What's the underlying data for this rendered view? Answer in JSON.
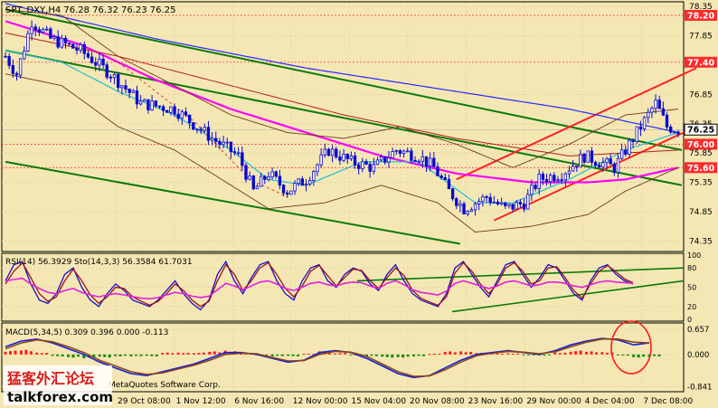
{
  "chart_data": [
    {
      "type": "candlestick",
      "panel": "price",
      "title": "SPT_DXY,H4  76.28 76.32 76.23 76.25",
      "ylim": [
        74.2,
        78.4
      ],
      "y_ticks": [
        74.35,
        74.85,
        75.35,
        75.85,
        76.35,
        76.85,
        77.85,
        78.35
      ],
      "price_labels": [
        {
          "value": 78.2,
          "text": "78.20",
          "color": "#ff2a2a"
        },
        {
          "value": 77.4,
          "text": "77.40",
          "color": "#ff2a2a"
        },
        {
          "value": 76.25,
          "text": "76.25",
          "color": "#ffffff"
        },
        {
          "value": 76.0,
          "text": "76.00",
          "color": "#ff2a2a"
        },
        {
          "value": 75.6,
          "text": "75.60",
          "color": "#ff2a2a"
        }
      ],
      "bars": 180,
      "x_tick_labels": [
        "29 Oct 08:00",
        "1 Nov 12:00",
        "6 Nov 16:00",
        "12 Nov 00:00",
        "15 Nov 04:00",
        "20 Nov 08:00",
        "23 Nov 16:00",
        "29 Nov 00:00",
        "4 Dec 04:00",
        "7 Dec 08:00"
      ],
      "close_anchors": [
        [
          0,
          77.5
        ],
        [
          3,
          77.2
        ],
        [
          7,
          78.1
        ],
        [
          12,
          77.8
        ],
        [
          20,
          77.6
        ],
        [
          28,
          77.2
        ],
        [
          36,
          76.7
        ],
        [
          45,
          76.6
        ],
        [
          55,
          76.1
        ],
        [
          62,
          75.8
        ],
        [
          66,
          75.2
        ],
        [
          70,
          75.5
        ],
        [
          75,
          75.2
        ],
        [
          80,
          75.4
        ],
        [
          86,
          75.9
        ],
        [
          92,
          75.7
        ],
        [
          98,
          75.6
        ],
        [
          104,
          75.9
        ],
        [
          110,
          75.8
        ],
        [
          114,
          75.6
        ],
        [
          118,
          75.2
        ],
        [
          122,
          74.9
        ],
        [
          125,
          75.0
        ],
        [
          128,
          75.1
        ],
        [
          133,
          74.9
        ],
        [
          138,
          75.0
        ],
        [
          142,
          75.4
        ],
        [
          148,
          75.5
        ],
        [
          154,
          75.8
        ],
        [
          158,
          75.7
        ],
        [
          162,
          75.6
        ],
        [
          166,
          76.0
        ],
        [
          170,
          76.4
        ],
        [
          173,
          76.7
        ],
        [
          176,
          76.3
        ],
        [
          179,
          76.25
        ]
      ],
      "lines": {
        "magenta_ma": [
          [
            0,
            78.1
          ],
          [
            20,
            77.7
          ],
          [
            40,
            77.1
          ],
          [
            60,
            76.6
          ],
          [
            80,
            76.2
          ],
          [
            100,
            75.8
          ],
          [
            120,
            75.5
          ],
          [
            140,
            75.35
          ],
          [
            155,
            75.35
          ],
          [
            165,
            75.4
          ],
          [
            179,
            75.6
          ]
        ],
        "blue_ma": [
          [
            0,
            78.4
          ],
          [
            40,
            77.8
          ],
          [
            80,
            77.3
          ],
          [
            120,
            76.9
          ],
          [
            150,
            76.6
          ],
          [
            179,
            76.2
          ]
        ],
        "cyan_ma": [
          [
            0,
            77.6
          ],
          [
            15,
            77.4
          ],
          [
            30,
            76.9
          ],
          [
            45,
            76.5
          ],
          [
            60,
            75.9
          ],
          [
            70,
            75.4
          ],
          [
            80,
            75.3
          ],
          [
            95,
            75.7
          ],
          [
            110,
            75.7
          ],
          [
            125,
            75.0
          ],
          [
            135,
            75.0
          ],
          [
            150,
            75.4
          ],
          [
            165,
            75.9
          ],
          [
            179,
            76.2
          ]
        ],
        "red_ma": [
          [
            0,
            77.9
          ],
          [
            30,
            77.5
          ],
          [
            60,
            77.0
          ],
          [
            90,
            76.5
          ],
          [
            120,
            76.1
          ],
          [
            150,
            75.8
          ],
          [
            179,
            75.9
          ]
        ],
        "bollinger_upper": [
          [
            0,
            78.3
          ],
          [
            15,
            78.2
          ],
          [
            30,
            77.5
          ],
          [
            45,
            77.0
          ],
          [
            60,
            76.5
          ],
          [
            75,
            76.2
          ],
          [
            90,
            76.1
          ],
          [
            105,
            76.3
          ],
          [
            120,
            76.0
          ],
          [
            135,
            75.6
          ],
          [
            150,
            76.0
          ],
          [
            165,
            76.5
          ],
          [
            179,
            76.6
          ]
        ],
        "bollinger_lower": [
          [
            0,
            77.2
          ],
          [
            15,
            77.0
          ],
          [
            30,
            76.3
          ],
          [
            45,
            75.9
          ],
          [
            60,
            75.3
          ],
          [
            70,
            74.9
          ],
          [
            85,
            75.0
          ],
          [
            100,
            75.3
          ],
          [
            115,
            75.0
          ],
          [
            125,
            74.5
          ],
          [
            140,
            74.6
          ],
          [
            155,
            74.8
          ],
          [
            165,
            75.2
          ],
          [
            179,
            75.6
          ]
        ],
        "dashed_red": [
          [
            30,
            77.4
          ],
          [
            50,
            76.4
          ],
          [
            65,
            75.4
          ],
          [
            75,
            75.1
          ]
        ]
      },
      "trendlines": [
        {
          "name": "green-channel-upper",
          "color": "#0a7a0a",
          "from": [
            0,
            78.3
          ],
          "to": [
            179,
            75.9
          ]
        },
        {
          "name": "green-channel-mid",
          "color": "#0a7a0a",
          "from": [
            0,
            77.6
          ],
          "to": [
            179,
            75.3
          ]
        },
        {
          "name": "green-channel-lower",
          "color": "#0a7a0a",
          "from": [
            0,
            75.7
          ],
          "to": [
            120,
            74.3
          ]
        },
        {
          "name": "red-channel-upper",
          "color": "#ff2222",
          "from": [
            120,
            75.4
          ],
          "to": [
            179,
            77.3
          ]
        },
        {
          "name": "red-channel-lower",
          "color": "#ff2222",
          "from": [
            130,
            74.7
          ],
          "to": [
            179,
            76.3
          ]
        }
      ]
    },
    {
      "type": "line",
      "panel": "rsi",
      "title": "RSI(14) 56.3929  Sto(14,3,3) 56.3584 61.7031",
      "ylim": [
        0,
        100
      ],
      "y_ticks": [
        0,
        20,
        50,
        80,
        100
      ],
      "series": [
        {
          "name": "Sto main",
          "color": "#1010d0",
          "values": [
            60,
            85,
            90,
            55,
            30,
            25,
            40,
            70,
            80,
            50,
            30,
            20,
            40,
            55,
            45,
            30,
            25,
            20,
            30,
            45,
            60,
            40,
            25,
            15,
            30,
            70,
            90,
            60,
            40,
            65,
            85,
            90,
            60,
            40,
            30,
            60,
            80,
            85,
            60,
            50,
            70,
            80,
            75,
            55,
            45,
            70,
            85,
            60,
            40,
            30,
            25,
            20,
            40,
            80,
            90,
            70,
            50,
            35,
            60,
            85,
            90,
            70,
            50,
            65,
            85,
            80,
            60,
            40,
            30,
            60,
            80,
            85,
            70,
            60,
            55
          ]
        },
        {
          "name": "Sto signal",
          "color": "#a01010",
          "values": [
            55,
            75,
            88,
            65,
            40,
            28,
            35,
            60,
            78,
            60,
            38,
            25,
            35,
            50,
            48,
            35,
            28,
            22,
            28,
            40,
            55,
            45,
            30,
            20,
            28,
            60,
            85,
            70,
            45,
            60,
            80,
            88,
            70,
            48,
            35,
            52,
            75,
            84,
            68,
            52,
            65,
            78,
            76,
            60,
            48,
            65,
            80,
            68,
            45,
            33,
            27,
            22,
            35,
            72,
            88,
            75,
            55,
            40,
            55,
            80,
            88,
            75,
            55,
            60,
            80,
            82,
            65,
            45,
            33,
            55,
            75,
            84,
            74,
            63,
            57
          ]
        },
        {
          "name": "RSI",
          "color": "#e020e0",
          "values": [
            60,
            62,
            64,
            55,
            48,
            42,
            40,
            45,
            48,
            42,
            38,
            35,
            38,
            40,
            38,
            35,
            33,
            32,
            34,
            38,
            42,
            40,
            36,
            34,
            36,
            46,
            56,
            52,
            46,
            52,
            58,
            60,
            55,
            48,
            45,
            50,
            56,
            58,
            54,
            52,
            56,
            58,
            57,
            52,
            48,
            56,
            60,
            54,
            46,
            42,
            40,
            38,
            44,
            56,
            60,
            56,
            52,
            48,
            52,
            58,
            60,
            56,
            52,
            54,
            58,
            58,
            56,
            52,
            50,
            54,
            58,
            60,
            58,
            57,
            56
          ]
        }
      ]
    },
    {
      "type": "bar",
      "panel": "macd",
      "title": "MACD(5,34,5) 0.309 0.396 0.000 -0.113",
      "ylim": [
        -0.9,
        0.75
      ],
      "y_ticks": [
        0.657,
        0.0,
        -0.841
      ],
      "series": [
        {
          "name": "MACD line",
          "color": "#1020e0",
          "values": [
            0.2,
            0.35,
            0.4,
            0.3,
            0.15,
            0.0,
            -0.2,
            -0.35,
            -0.5,
            -0.55,
            -0.45,
            -0.35,
            -0.25,
            -0.1,
            0.05,
            0.05,
            0.0,
            -0.1,
            -0.2,
            -0.15,
            0.05,
            0.1,
            0.05,
            -0.1,
            -0.3,
            -0.5,
            -0.6,
            -0.55,
            -0.35,
            -0.15,
            0.0,
            0.05,
            0.1,
            0.05,
            0.0,
            0.1,
            0.25,
            0.35,
            0.42,
            0.38,
            0.25,
            0.3
          ]
        },
        {
          "name": "Signal line",
          "color": "#8b4513",
          "values": [
            0.15,
            0.3,
            0.38,
            0.33,
            0.2,
            0.05,
            -0.15,
            -0.3,
            -0.45,
            -0.52,
            -0.48,
            -0.38,
            -0.28,
            -0.15,
            0.0,
            0.03,
            0.02,
            -0.08,
            -0.17,
            -0.16,
            0.0,
            0.08,
            0.06,
            -0.05,
            -0.25,
            -0.45,
            -0.57,
            -0.56,
            -0.4,
            -0.2,
            -0.03,
            0.03,
            0.08,
            0.06,
            0.02,
            0.07,
            0.2,
            0.32,
            0.4,
            0.4,
            0.32,
            0.3
          ]
        },
        {
          "name": "Histogram",
          "color_pos": "#ff1a1a",
          "color_neg": "#0a8a0a",
          "values": [
            0.1,
            0.12,
            0.05,
            -0.05,
            -0.08,
            -0.1,
            -0.08,
            -0.05,
            -0.05,
            -0.05,
            0.05,
            0.05,
            0.05,
            0.08,
            0.1,
            0.03,
            -0.02,
            -0.05,
            -0.05,
            0.02,
            0.08,
            0.04,
            -0.02,
            -0.05,
            -0.08,
            -0.08,
            -0.05,
            0.02,
            0.08,
            0.08,
            0.05,
            0.03,
            0.03,
            -0.02,
            -0.03,
            0.05,
            0.1,
            0.08,
            0.06,
            -0.03,
            -0.08,
            -0.06
          ]
        }
      ]
    }
  ],
  "watermark": {
    "cn": "猛客外汇论坛",
    "site": "talkforex.com"
  },
  "copyright": "MetaQuotes Software Corp."
}
